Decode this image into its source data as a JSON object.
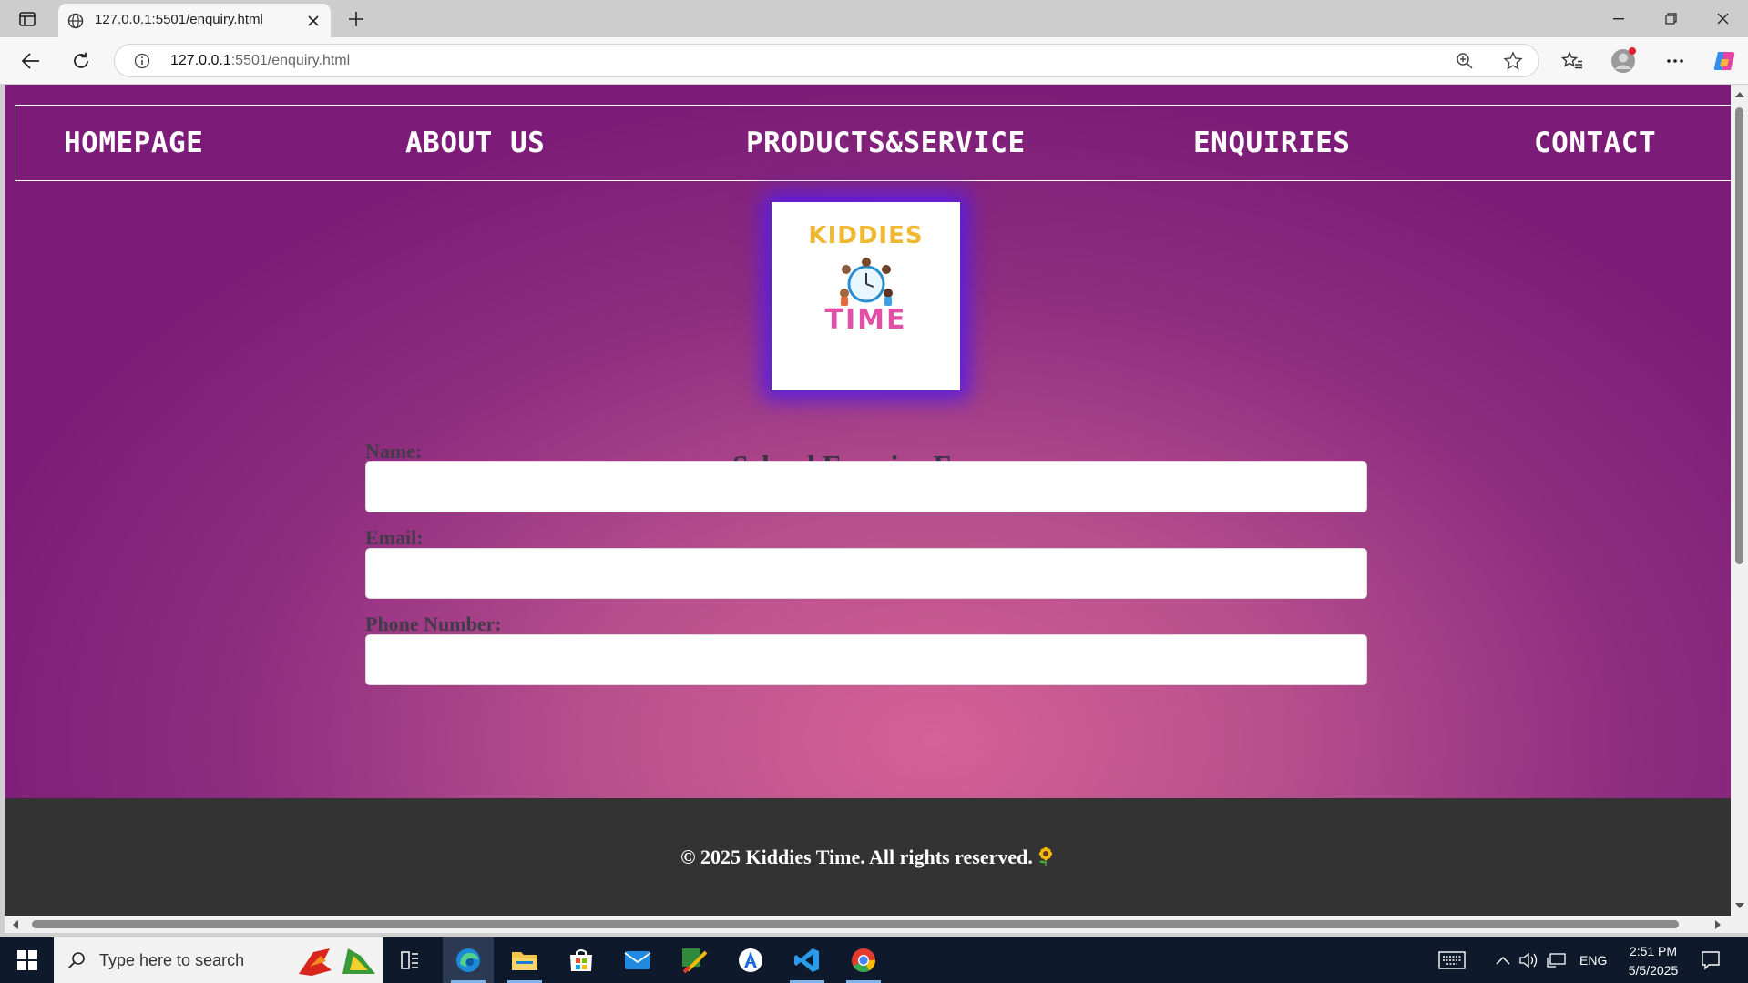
{
  "browser": {
    "tab_title": "127.0.0.1:5501/enquiry.html",
    "url_host": "127.0.0.1",
    "url_rest": ":5501/enquiry.html"
  },
  "site": {
    "nav": [
      "HOMEPAGE",
      "ABOUT US",
      "PRODUCTS&SERVICE",
      "ENQUIRIES",
      "CONTACT"
    ],
    "logo_top_text": "KIDDIES",
    "logo_bottom_text": "TIME",
    "form_title": "School Enquiry Form",
    "fields": [
      {
        "label": "Name:",
        "value": ""
      },
      {
        "label": "Email:",
        "value": ""
      },
      {
        "label": "Phone Number:",
        "value": ""
      }
    ],
    "footer": "© 2025 Kiddies Time. All rights reserved."
  },
  "taskbar": {
    "search_placeholder": "Type here to search",
    "language": "ENG",
    "time": "2:51 PM",
    "date": "5/5/2025"
  },
  "colors": {
    "bg_center": "#d56296",
    "bg_edge": "#7c1c78",
    "logo_glow": "#5a1ee0",
    "footer_bg": "#333333",
    "taskbar_bg": "#0e1a2b"
  }
}
